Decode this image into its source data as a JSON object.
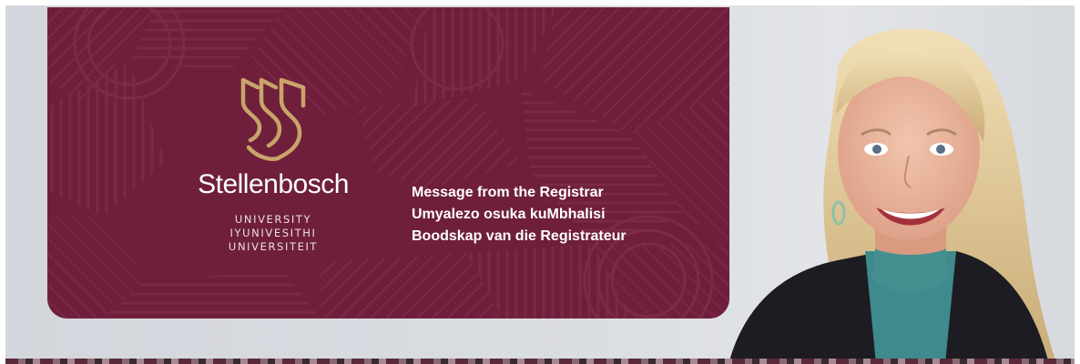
{
  "logo": {
    "name": "Stellenbosch",
    "subtitle_lines": [
      "UNIVERSITY",
      "IYUNIVESITHI",
      "UNIVERSITEIT"
    ]
  },
  "messages": [
    "Message from the Registrar",
    "Umyalezo osuka kuMbhalisi",
    "Boodskap van die Registrateur"
  ],
  "colors": {
    "maroon": "#6f1f3b",
    "gold": "#c9a46a",
    "background": "#d8dbe0"
  },
  "images": {
    "portrait": "smiling-woman-portrait"
  }
}
